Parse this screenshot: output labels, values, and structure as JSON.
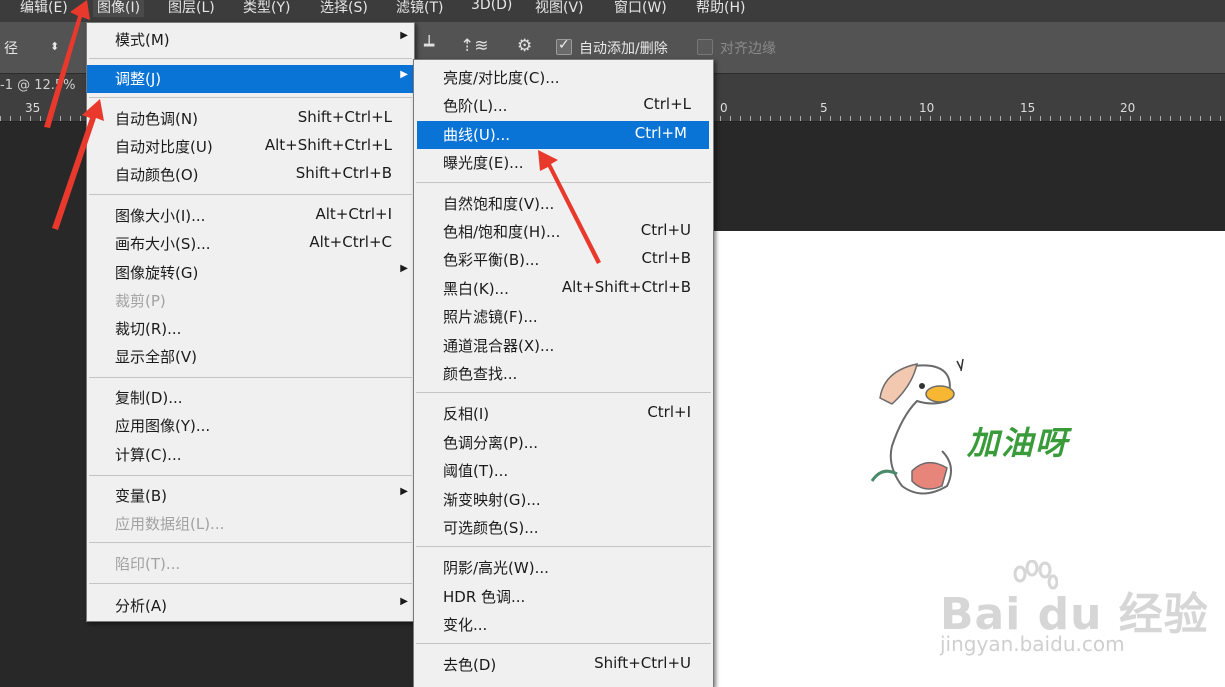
{
  "menubar": {
    "items": [
      "编辑(E)",
      "图像(I)",
      "图层(L)",
      "类型(Y)",
      "选择(S)",
      "滤镜(T)",
      "3D(D)",
      "视图(V)",
      "窗口(W)",
      "帮助(H)"
    ]
  },
  "options": {
    "path_label": "径",
    "auto_add_delete": "自动添加/删除",
    "align_edges": "对齐边缘"
  },
  "tab": {
    "title": "-1 @ 12.5%"
  },
  "ruler": {
    "labels": [
      "35",
      "0",
      "5",
      "10",
      "15",
      "20"
    ]
  },
  "image_menu": {
    "items": [
      {
        "label": "模式(M)",
        "shortcut": "",
        "submenu": true
      },
      {
        "label": "调整(J)",
        "shortcut": "",
        "submenu": true,
        "highlighted": true
      },
      {
        "label": "自动色调(N)",
        "shortcut": "Shift+Ctrl+L"
      },
      {
        "label": "自动对比度(U)",
        "shortcut": "Alt+Shift+Ctrl+L"
      },
      {
        "label": "自动颜色(O)",
        "shortcut": "Shift+Ctrl+B"
      },
      {
        "label": "图像大小(I)...",
        "shortcut": "Alt+Ctrl+I"
      },
      {
        "label": "画布大小(S)...",
        "shortcut": "Alt+Ctrl+C"
      },
      {
        "label": "图像旋转(G)",
        "shortcut": "",
        "submenu": true
      },
      {
        "label": "裁剪(P)",
        "shortcut": "",
        "disabled": true
      },
      {
        "label": "裁切(R)...",
        "shortcut": ""
      },
      {
        "label": "显示全部(V)",
        "shortcut": ""
      },
      {
        "label": "复制(D)...",
        "shortcut": ""
      },
      {
        "label": "应用图像(Y)...",
        "shortcut": ""
      },
      {
        "label": "计算(C)...",
        "shortcut": ""
      },
      {
        "label": "变量(B)",
        "shortcut": "",
        "submenu": true
      },
      {
        "label": "应用数据组(L)...",
        "shortcut": "",
        "disabled": true
      },
      {
        "label": "陷印(T)...",
        "shortcut": "",
        "disabled": true
      },
      {
        "label": "分析(A)",
        "shortcut": "",
        "submenu": true
      }
    ]
  },
  "adjust_menu": {
    "items": [
      {
        "label": "亮度/对比度(C)...",
        "shortcut": ""
      },
      {
        "label": "色阶(L)...",
        "shortcut": "Ctrl+L"
      },
      {
        "label": "曲线(U)...",
        "shortcut": "Ctrl+M",
        "highlighted": true
      },
      {
        "label": "曝光度(E)...",
        "shortcut": ""
      },
      {
        "label": "自然饱和度(V)...",
        "shortcut": ""
      },
      {
        "label": "色相/饱和度(H)...",
        "shortcut": "Ctrl+U"
      },
      {
        "label": "色彩平衡(B)...",
        "shortcut": "Ctrl+B"
      },
      {
        "label": "黑白(K)...",
        "shortcut": "Alt+Shift+Ctrl+B"
      },
      {
        "label": "照片滤镜(F)...",
        "shortcut": ""
      },
      {
        "label": "通道混合器(X)...",
        "shortcut": ""
      },
      {
        "label": "颜色查找...",
        "shortcut": ""
      },
      {
        "label": "反相(I)",
        "shortcut": "Ctrl+I"
      },
      {
        "label": "色调分离(P)...",
        "shortcut": ""
      },
      {
        "label": "阈值(T)...",
        "shortcut": ""
      },
      {
        "label": "渐变映射(G)...",
        "shortcut": ""
      },
      {
        "label": "可选颜色(S)...",
        "shortcut": ""
      },
      {
        "label": "阴影/高光(W)...",
        "shortcut": ""
      },
      {
        "label": "HDR 色调...",
        "shortcut": ""
      },
      {
        "label": "变化...",
        "shortcut": ""
      },
      {
        "label": "去色(D)",
        "shortcut": "Shift+Ctrl+U"
      }
    ]
  },
  "canvas": {
    "sticker_text": "加油呀"
  },
  "watermark": {
    "logo": "Bai du 经验",
    "url": "jingyan.baidu.com"
  },
  "colors": {
    "highlight": "#0a73d6",
    "annotation_arrow": "#e8392c"
  }
}
